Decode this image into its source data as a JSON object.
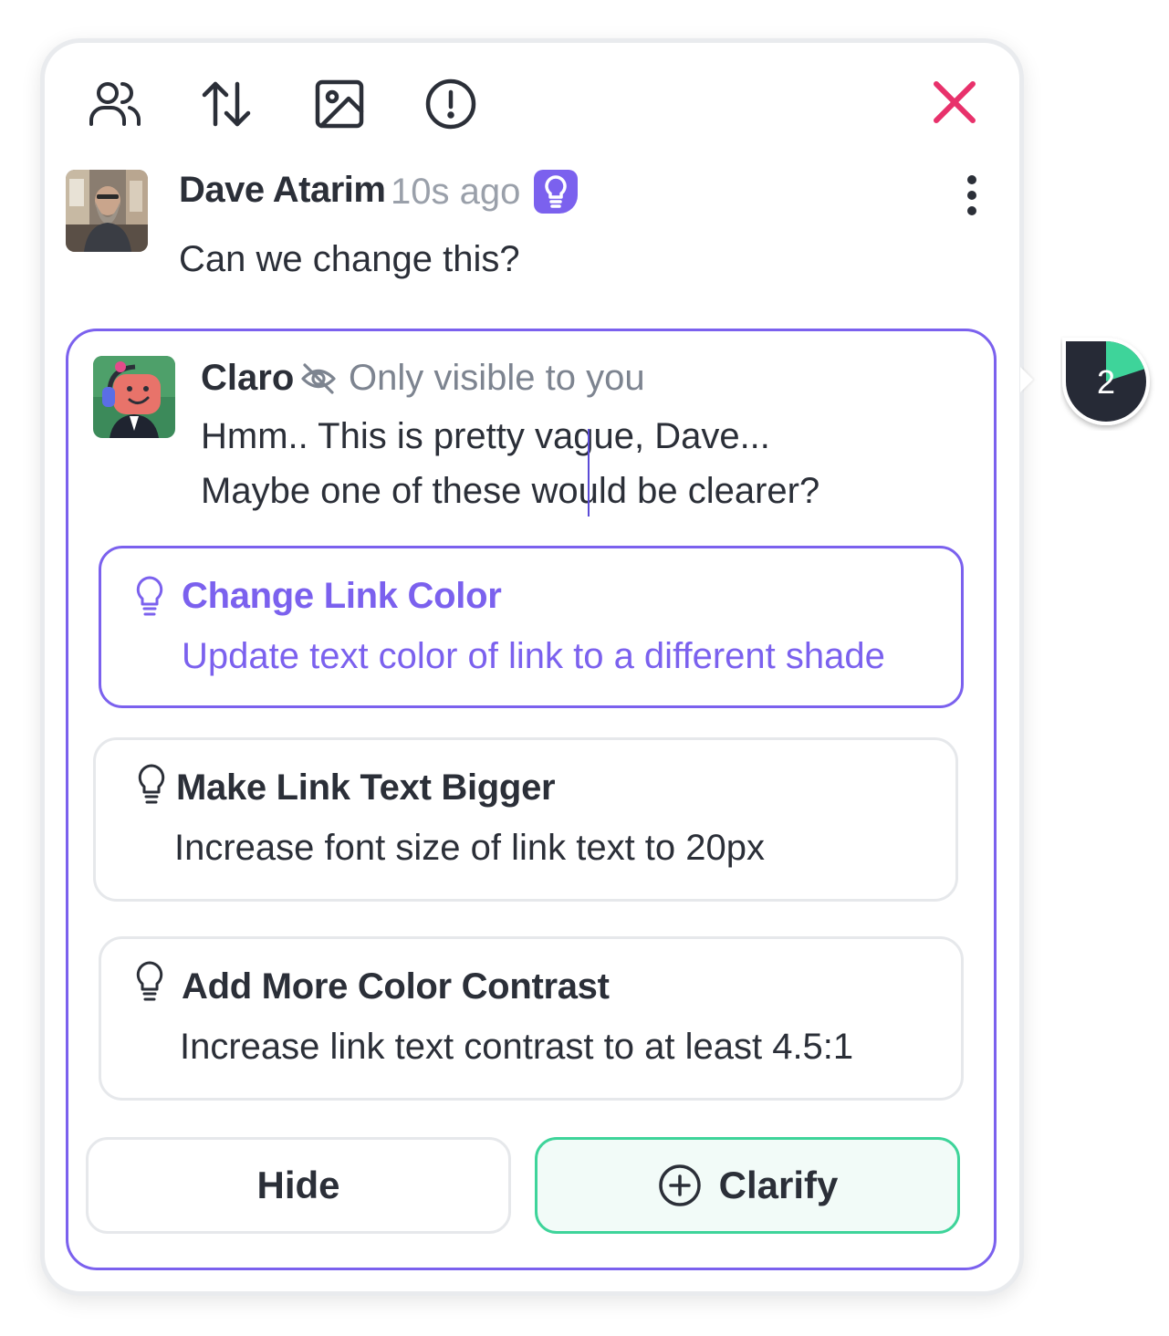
{
  "toolbar": {
    "icons": [
      "users-icon",
      "sort-icon",
      "image-icon",
      "alert-icon"
    ],
    "close_icon": "close-icon"
  },
  "colors": {
    "accent_purple": "#7b61ee",
    "accent_green": "#3ed49a",
    "close_red": "#e8316b",
    "text_dark": "#2b2f38",
    "text_muted": "#9aa0aa",
    "badge_dark": "#262a36"
  },
  "comment": {
    "author": "Dave Atarim",
    "time": "10s ago",
    "message": "Can we change this?",
    "badge_icon": "lightbulb-icon",
    "menu_icon": "kebab-icon"
  },
  "assistant": {
    "name": "Claro",
    "visibility_icon": "eye-off-icon",
    "visibility_text": "Only visible to you",
    "line1": "Hmm.. This is pretty vague, Dave...",
    "line2": "Maybe one of these would be clearer?"
  },
  "suggestions": [
    {
      "title": "Change Link Color",
      "description": "Update text color of link to a different shade"
    },
    {
      "title": "Make Link Text Bigger",
      "description": "Increase font size of link text to 20px"
    },
    {
      "title": "Add More Color Contrast",
      "description": "Increase link text contrast to at least 4.5:1"
    }
  ],
  "actions": {
    "hide_label": "Hide",
    "clarify_label": "Clarify"
  },
  "counter": {
    "value": "2",
    "progress": 0.2
  }
}
